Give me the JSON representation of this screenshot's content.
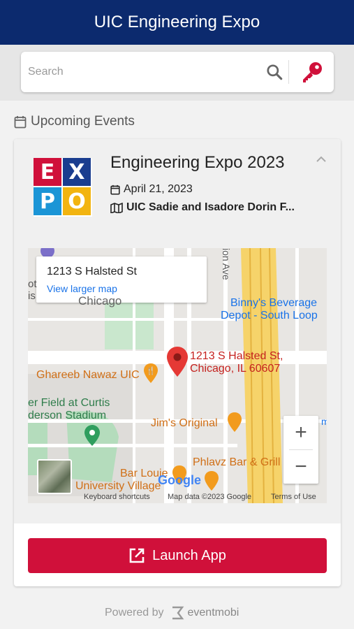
{
  "header": {
    "title": "UIC Engineering Expo"
  },
  "search": {
    "placeholder": "Search",
    "icons": [
      "search-icon",
      "key-icon"
    ]
  },
  "section": {
    "title": "Upcoming Events",
    "icon": "calendar-icon"
  },
  "event": {
    "logo_letters": [
      "E",
      "X",
      "P",
      "O"
    ],
    "title": "Engineering Expo 2023",
    "date": "April 21, 2023",
    "location": "UIC Sadie and Isadore Dorin F..."
  },
  "map": {
    "info_address": "1213 S Halsted St",
    "view_larger": "View larger map",
    "pin_label_line1": "1213 S Halsted St,",
    "pin_label_line2": "Chicago, IL 60607",
    "labels": {
      "binnys_1": "Binny's Beverage",
      "binnys_2": "Depot - South Loop",
      "ghareeb": "Ghareeb Nawaz UIC",
      "field_1": "er Field at Curtis",
      "field_2": "derson Stadium",
      "jims": "Jim's Original",
      "phlavz": "Phlavz Bar & Grill",
      "bar_louie": "Bar Louie",
      "univ_village": "University Village",
      "chicago_partial": "Chicago",
      "ave_partial": "ion Ave",
      "ot": "ot",
      "is": "is",
      "rn": "m"
    },
    "zoom_in": "+",
    "zoom_out": "−",
    "google": "Google",
    "footer_shortcuts": "Keyboard shortcuts",
    "footer_data": "Map data ©2023 Google",
    "footer_terms": "Terms of Use"
  },
  "launch": {
    "label": "Launch App"
  },
  "footer": {
    "powered_by": "Powered by",
    "brand": "eventmobi"
  },
  "colors": {
    "header": "#0c2a6e",
    "accent": "#d0103a",
    "key": "#d0103a"
  }
}
